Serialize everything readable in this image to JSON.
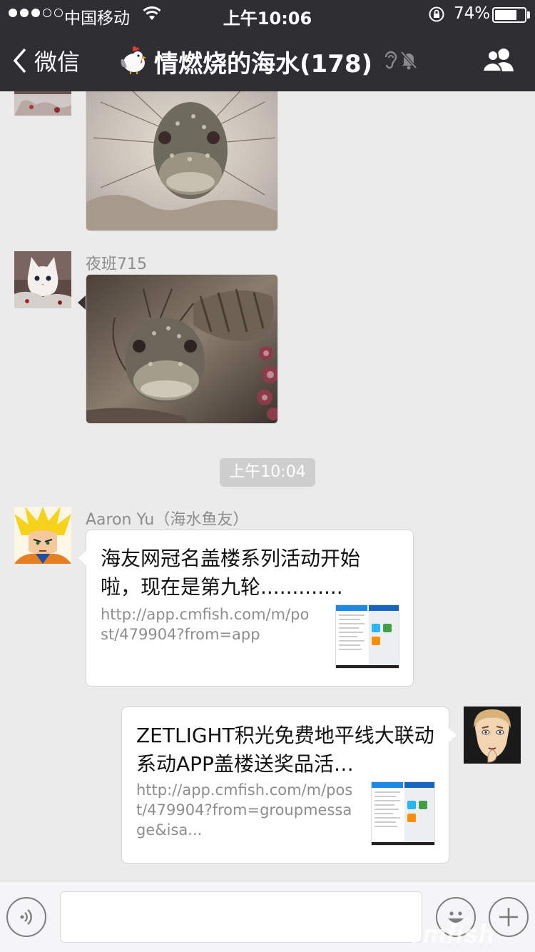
{
  "status_bar": {
    "carrier": "中国移动",
    "time": "上午10:06",
    "battery_text": "74%",
    "battery_level": 0.74
  },
  "nav": {
    "back_label": "微信",
    "title": "情燃烧的海水(178)"
  },
  "messages": {
    "m2_sender": "夜班715",
    "timestamp": "上午10:04",
    "m3_sender": "Aaron  Yu（海水鱼友）",
    "m3_title": "海友网冠名盖楼系列活动开始啦，现在是第九轮.............",
    "m3_url": "http://app.cmfish.com/m/post/479904?from=app",
    "m4_title": "ZETLIGHT积光免费地平线大联动系动APP盖楼送奖品活…",
    "m4_url": "http://app.cmfish.com/m/post/479904?from=groupmessage&isa..."
  },
  "watermark": "cmfish"
}
